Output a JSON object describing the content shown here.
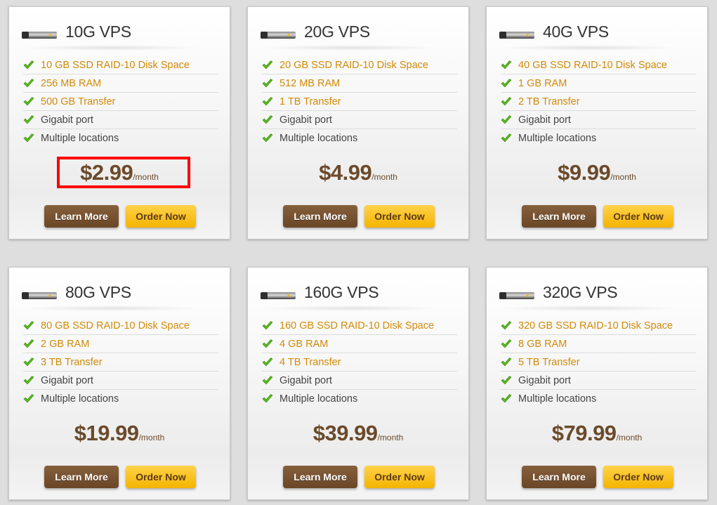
{
  "colors": {
    "highlight": "#d28a08",
    "price": "#6b4a2b",
    "learn_button": "#6a4627",
    "order_button": "#f4b400",
    "selection_box": "#ff0000"
  },
  "plans": [
    {
      "title": "10G VPS",
      "features": [
        "10 GB SSD RAID-10 Disk Space",
        "256 MB RAM",
        "500 GB Transfer",
        "Gigabit port",
        "Multiple locations"
      ],
      "price": "$2.99",
      "per": "/month",
      "learn_more": "Learn More",
      "order_now": "Order Now"
    },
    {
      "title": "20G VPS",
      "features": [
        "20 GB SSD RAID-10 Disk Space",
        "512 MB RAM",
        "1 TB Transfer",
        "Gigabit port",
        "Multiple locations"
      ],
      "price": "$4.99",
      "per": "/month",
      "learn_more": "Learn More",
      "order_now": "Order Now"
    },
    {
      "title": "40G VPS",
      "features": [
        "40 GB SSD RAID-10 Disk Space",
        "1 GB RAM",
        "2 TB Transfer",
        "Gigabit port",
        "Multiple locations"
      ],
      "price": "$9.99",
      "per": "/month",
      "learn_more": "Learn More",
      "order_now": "Order Now"
    },
    {
      "title": "80G VPS",
      "features": [
        "80 GB SSD RAID-10 Disk Space",
        "2 GB RAM",
        "3 TB Transfer",
        "Gigabit port",
        "Multiple locations"
      ],
      "price": "$19.99",
      "per": "/month",
      "learn_more": "Learn More",
      "order_now": "Order Now"
    },
    {
      "title": "160G VPS",
      "features": [
        "160 GB SSD RAID-10 Disk Space",
        "4 GB RAM",
        "4 TB Transfer",
        "Gigabit port",
        "Multiple locations"
      ],
      "price": "$39.99",
      "per": "/month",
      "learn_more": "Learn More",
      "order_now": "Order Now"
    },
    {
      "title": "320G VPS",
      "features": [
        "320 GB SSD RAID-10 Disk Space",
        "8 GB RAM",
        "5 TB Transfer",
        "Gigabit port",
        "Multiple locations"
      ],
      "price": "$79.99",
      "per": "/month",
      "learn_more": "Learn More",
      "order_now": "Order Now"
    }
  ]
}
